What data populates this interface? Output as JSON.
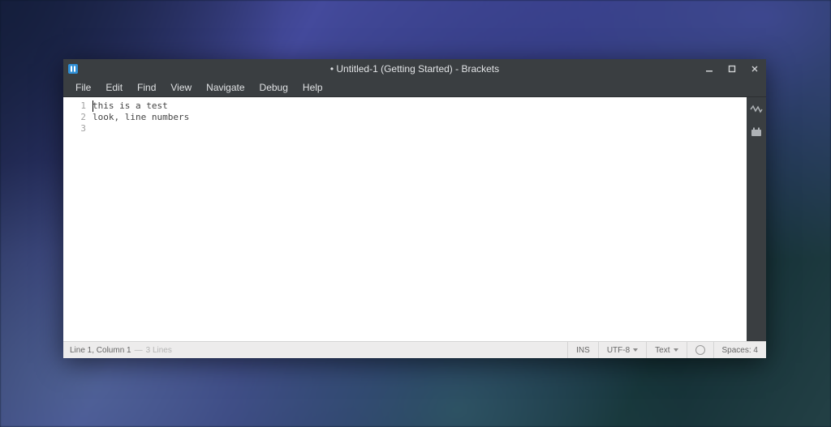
{
  "window": {
    "title": "• Untitled-1 (Getting Started) - Brackets"
  },
  "menu": {
    "file": "File",
    "edit": "Edit",
    "find": "Find",
    "view": "View",
    "navigate": "Navigate",
    "debug": "Debug",
    "help": "Help"
  },
  "editor": {
    "gutter": {
      "l1": "1",
      "l2": "2",
      "l3": "3"
    },
    "lines": {
      "l1": "this is a test",
      "l2": "look, line numbers",
      "l3": ""
    }
  },
  "statusbar": {
    "position": "Line 1, Column 1",
    "separator": " — ",
    "line_count": "3 Lines",
    "insert_mode": "INS",
    "encoding": "UTF-8",
    "language": "Text",
    "spaces": "Spaces: 4"
  }
}
